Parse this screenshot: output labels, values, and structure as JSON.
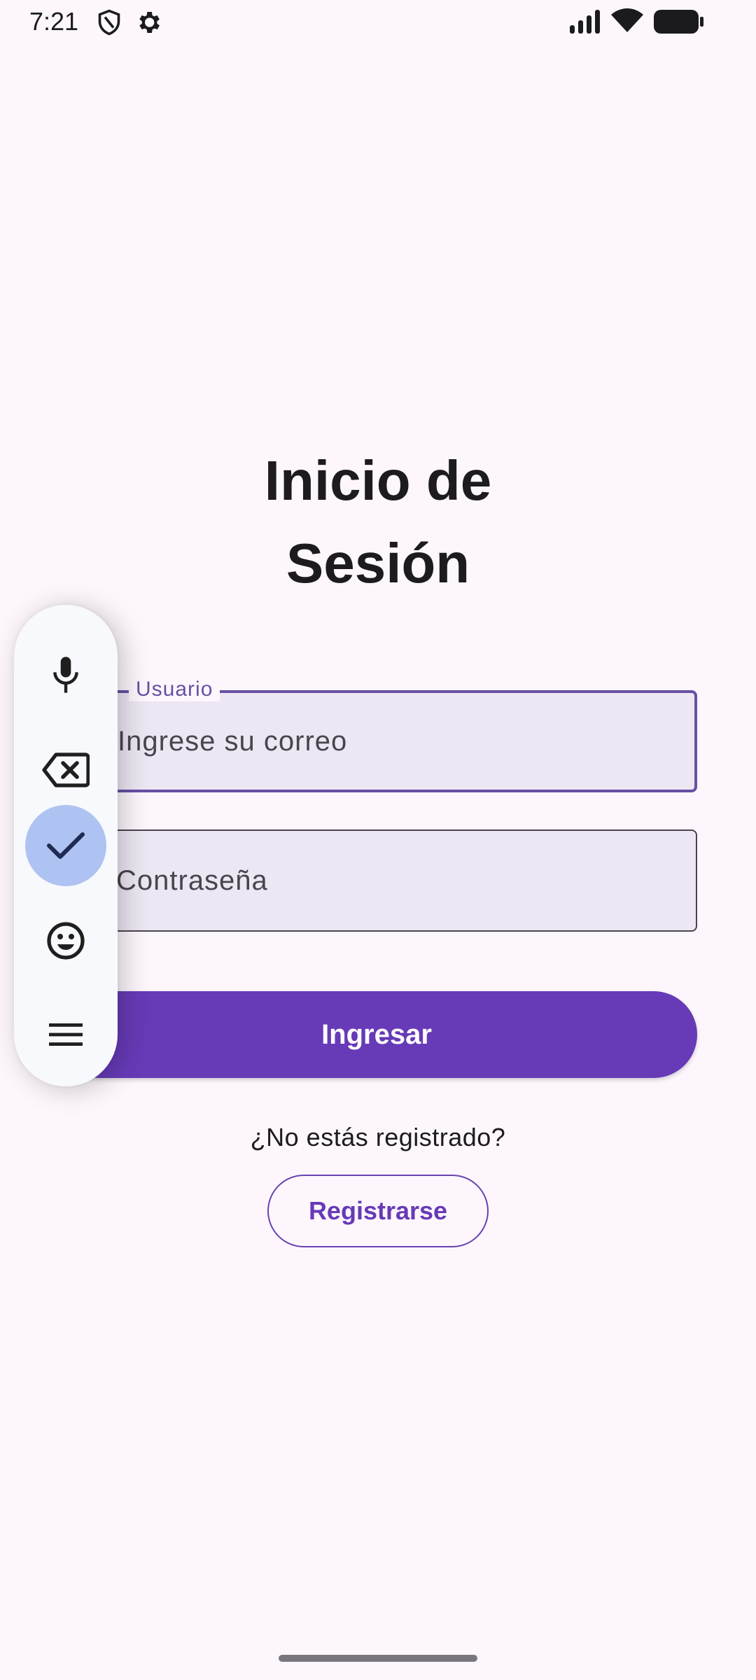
{
  "status_bar": {
    "time": "7:21",
    "left_icons": [
      "shield-icon",
      "gear-icon"
    ],
    "right_icons": [
      "signal-icon",
      "wifi-icon",
      "battery-icon"
    ]
  },
  "login": {
    "title_line1": "Inicio de",
    "title_line2": "Sesión",
    "username_label": "Usuario",
    "username_placeholder": "Ingrese su correo",
    "password_placeholder": "Contraseña",
    "submit_label": "Ingresar",
    "register_prompt": "¿No estás registrado?",
    "register_label": "Registrarse"
  },
  "floating_toolbar": {
    "items": [
      "mic-icon",
      "backspace-icon",
      "check-icon",
      "emoji-icon",
      "menu-icon"
    ],
    "active_item": "check-icon"
  },
  "colors": {
    "background": "#fdf7fd",
    "primary": "#673ab7",
    "field_fill": "#ede7f3",
    "toolbar_active": "#aec3f2"
  }
}
